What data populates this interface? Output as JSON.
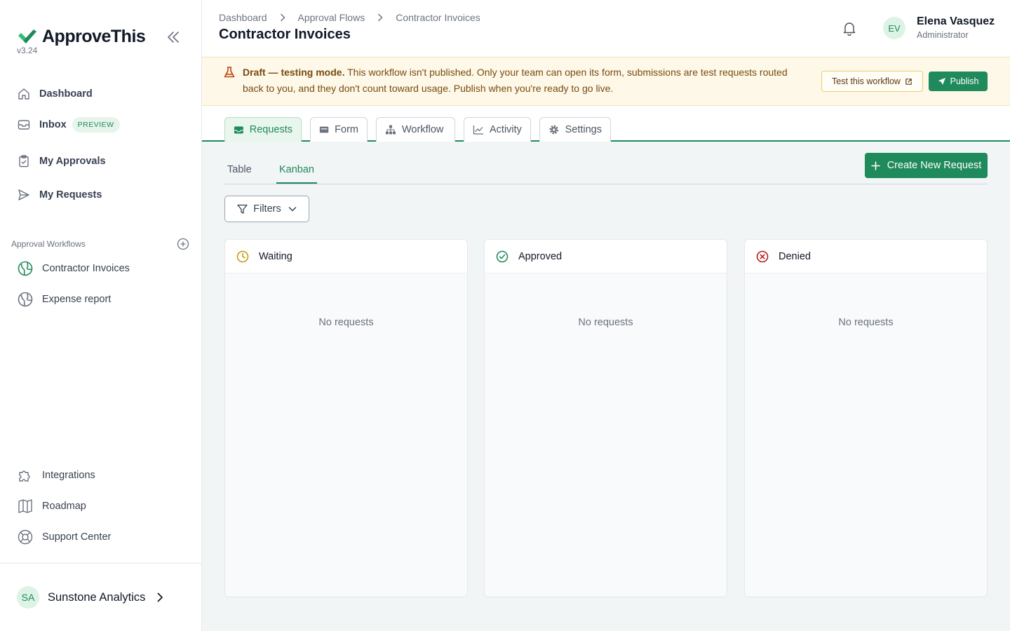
{
  "app": {
    "name": "ApproveThis",
    "version": "v3.24",
    "brand_color": "#1f8a5b"
  },
  "sidebar": {
    "nav": [
      {
        "label": "Dashboard",
        "icon": "home-icon"
      },
      {
        "label": "Inbox",
        "icon": "inbox-icon",
        "badge": "PREVIEW"
      },
      {
        "label": "My Approvals",
        "icon": "clipboard-check-icon"
      },
      {
        "label": "My Requests",
        "icon": "send-icon"
      }
    ],
    "section_label": "Approval Workflows",
    "workflows": [
      {
        "label": "Contractor Invoices",
        "icon": "globe-icon",
        "active": true
      },
      {
        "label": "Expense report",
        "icon": "globe-icon",
        "active": false
      }
    ],
    "footer_nav": [
      {
        "label": "Integrations",
        "icon": "puzzle-icon"
      },
      {
        "label": "Roadmap",
        "icon": "map-icon"
      },
      {
        "label": "Support Center",
        "icon": "lifebuoy-icon"
      }
    ],
    "org": {
      "initials": "SA",
      "name": "Sunstone Analytics"
    }
  },
  "header": {
    "breadcrumb": [
      "Dashboard",
      "Approval Flows",
      "Contractor Invoices"
    ],
    "title": "Contractor Invoices",
    "user": {
      "initials": "EV",
      "name": "Elena Vasquez",
      "role": "Administrator"
    }
  },
  "banner": {
    "strong": "Draft — testing mode.",
    "text": " This workflow isn't published. Only your team can open its form, submissions are test requests routed back to you, and they don't count toward usage. Publish when you're ready to go live.",
    "test_label": "Test this workflow",
    "publish_label": "Publish"
  },
  "tabs": [
    {
      "label": "Requests",
      "icon": "inbox-tray-icon",
      "active": true
    },
    {
      "label": "Form",
      "icon": "form-icon",
      "active": false
    },
    {
      "label": "Workflow",
      "icon": "hierarchy-icon",
      "active": false
    },
    {
      "label": "Activity",
      "icon": "chart-line-icon",
      "active": false
    },
    {
      "label": "Settings",
      "icon": "gear-icon",
      "active": false
    }
  ],
  "views": {
    "tabs": [
      "Table",
      "Kanban"
    ],
    "active": "Kanban",
    "create_label": "Create New Request",
    "filters_label": "Filters"
  },
  "kanban": [
    {
      "title": "Waiting",
      "icon": "clock-icon",
      "color": "#c99a0c",
      "empty": "No requests"
    },
    {
      "title": "Approved",
      "icon": "check-circle-icon",
      "color": "#1f8a5b",
      "empty": "No requests"
    },
    {
      "title": "Denied",
      "icon": "x-circle-icon",
      "color": "#b91c1c",
      "empty": "No requests"
    }
  ]
}
